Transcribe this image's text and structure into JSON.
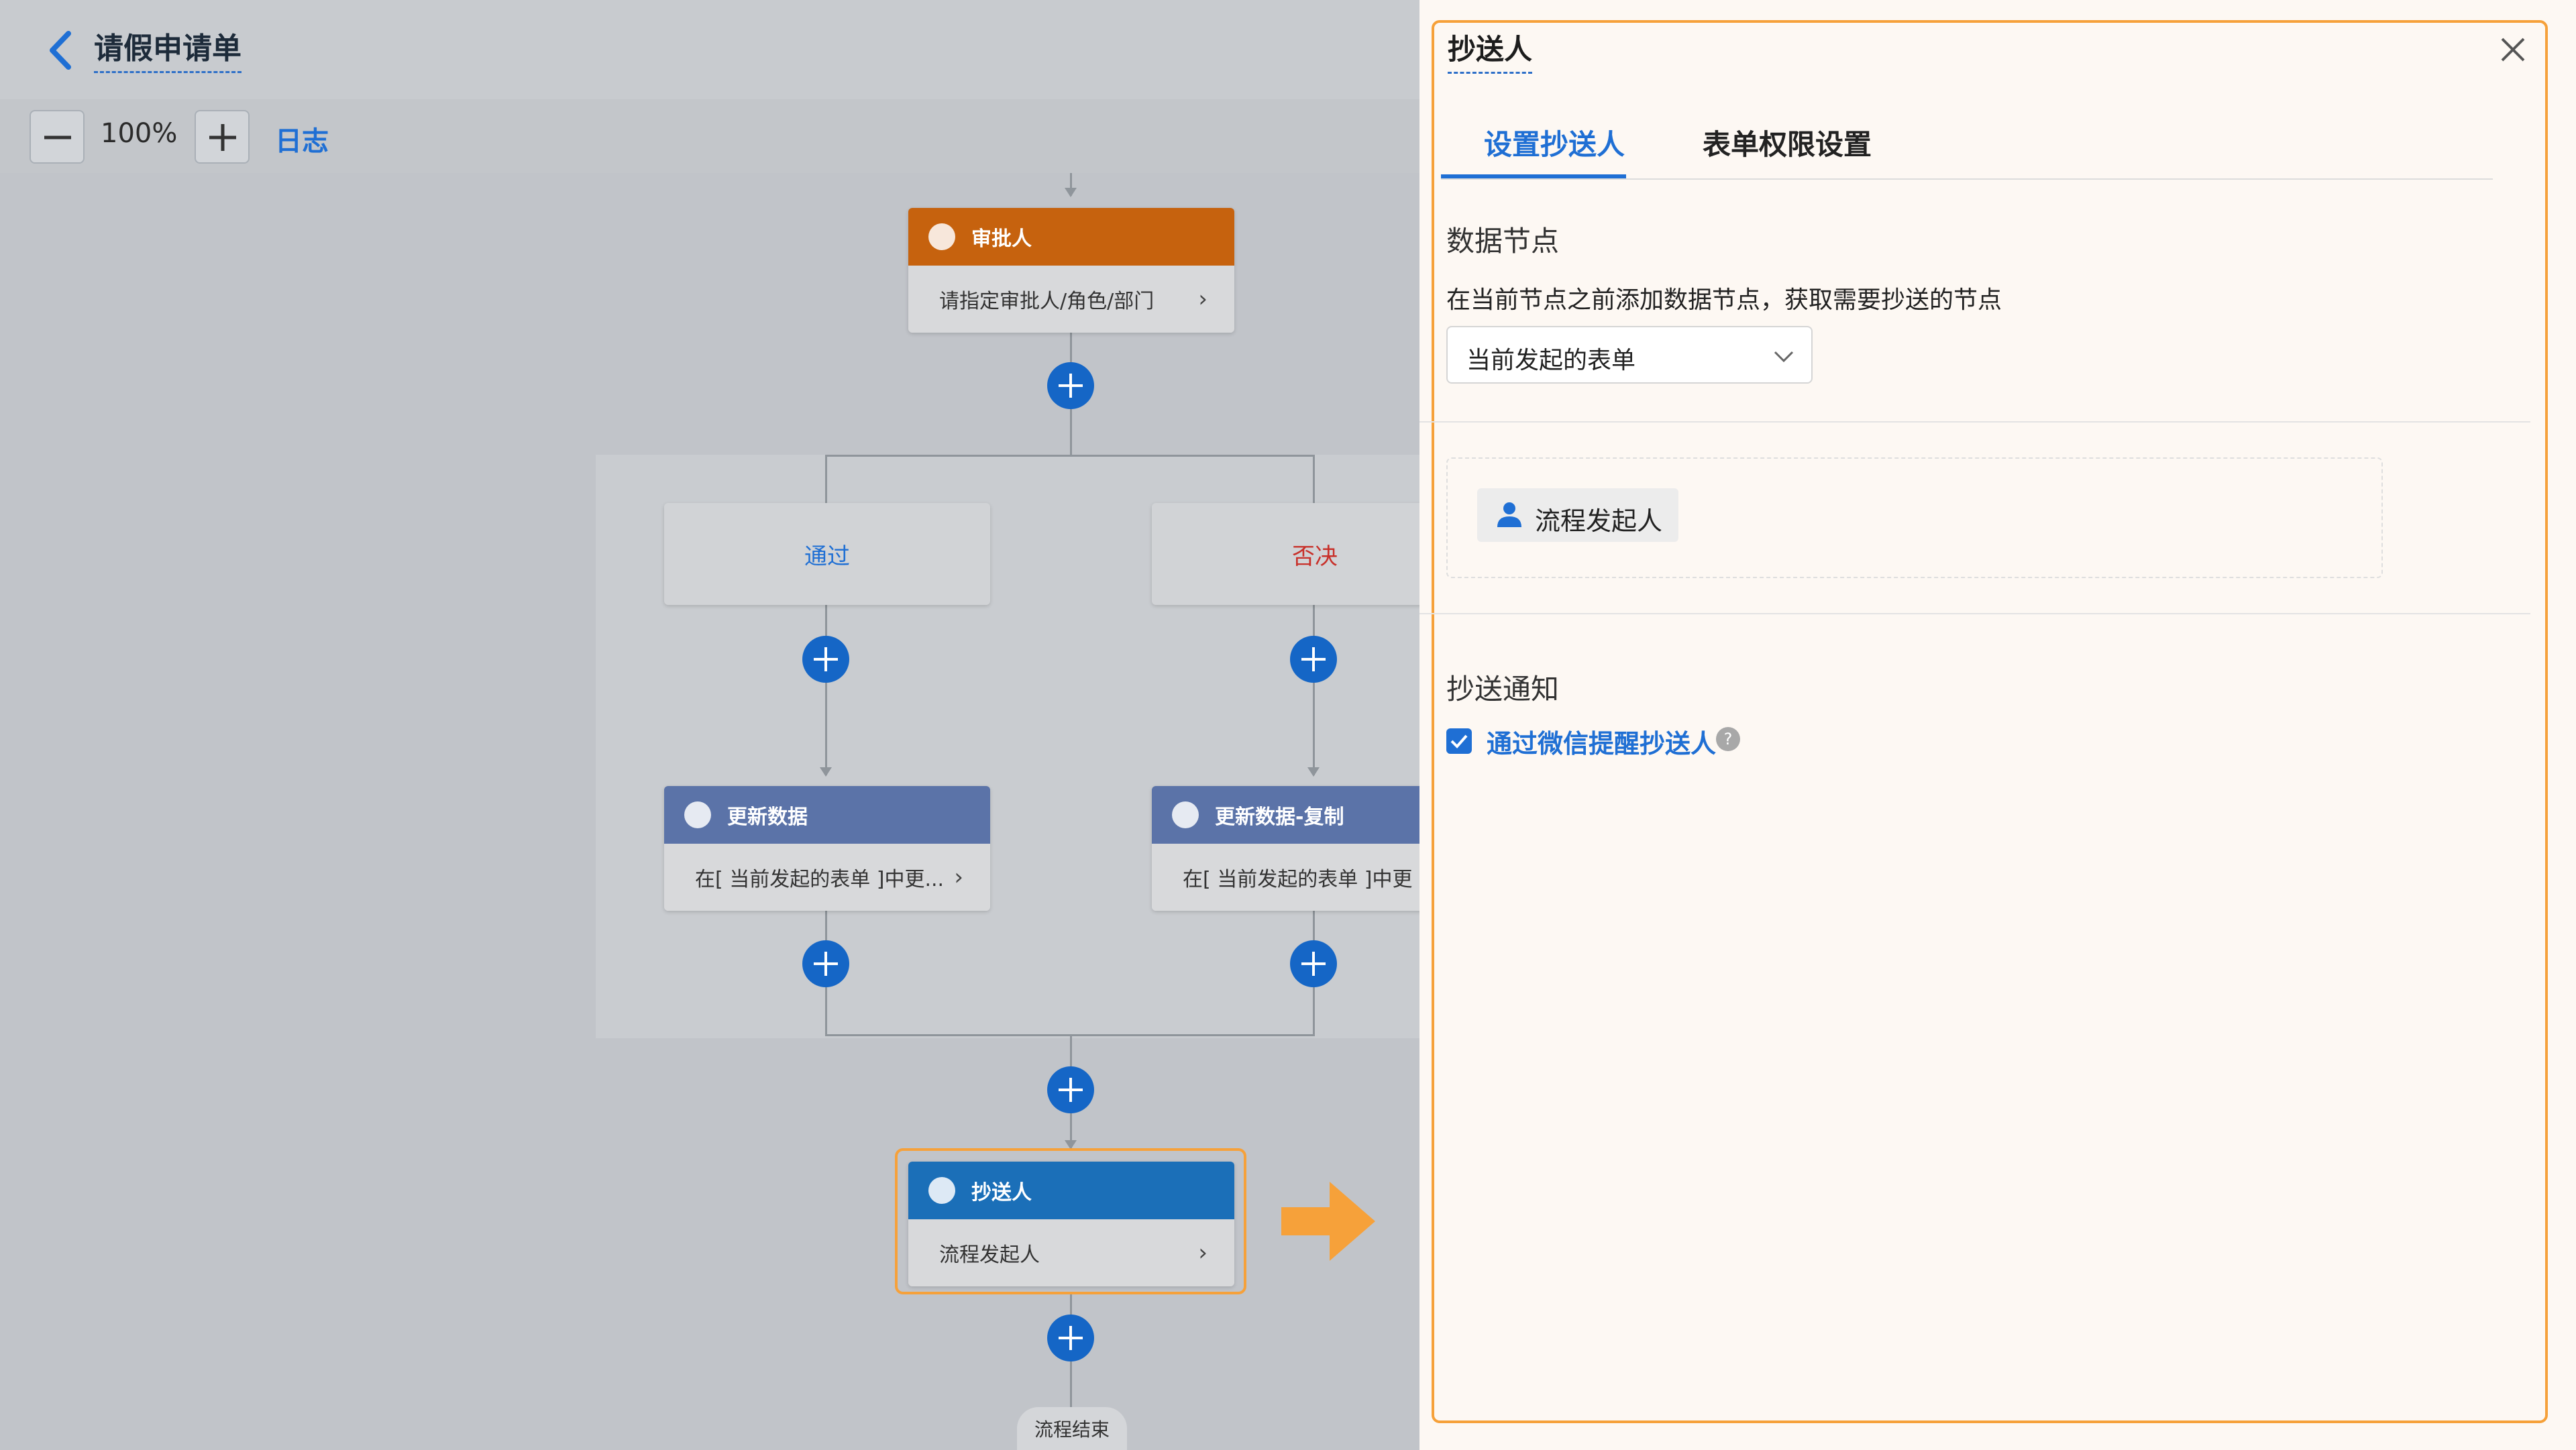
{
  "header": {
    "title": "请假申请单"
  },
  "toolbar": {
    "zoom": "100%",
    "log_label": "日志"
  },
  "flow": {
    "approver": {
      "title": "审批人",
      "body": "请指定审批人/角色/部门"
    },
    "conditions": {
      "pass": "通过",
      "reject": "否决"
    },
    "update_left": {
      "title": "更新数据",
      "body": "在[ 当前发起的表单 ]中更..."
    },
    "update_right": {
      "title": "更新数据-复制",
      "body": "在[ 当前发起的表单 ]中更"
    },
    "cc": {
      "title": "抄送人",
      "body": "流程发起人"
    },
    "end": "流程结束"
  },
  "panel": {
    "title": "抄送人",
    "tabs": [
      {
        "label": "设置抄送人"
      },
      {
        "label": "表单权限设置"
      }
    ],
    "data_node": {
      "title": "数据节点",
      "desc": "在当前节点之前添加数据节点，获取需要抄送的节点",
      "select_value": "当前发起的表单"
    },
    "chip": "流程发起人",
    "notify": {
      "title": "抄送通知",
      "checkbox_label": "通过微信提醒抄送人",
      "checked": true
    }
  },
  "colors": {
    "approver": "#c6620e",
    "update": "#5b73a8",
    "cc": "#1b6fb8",
    "accent": "#1f6fd4",
    "highlight": "#f6a13a",
    "reject": "#c8302a",
    "pass": "#1f6fd4"
  }
}
